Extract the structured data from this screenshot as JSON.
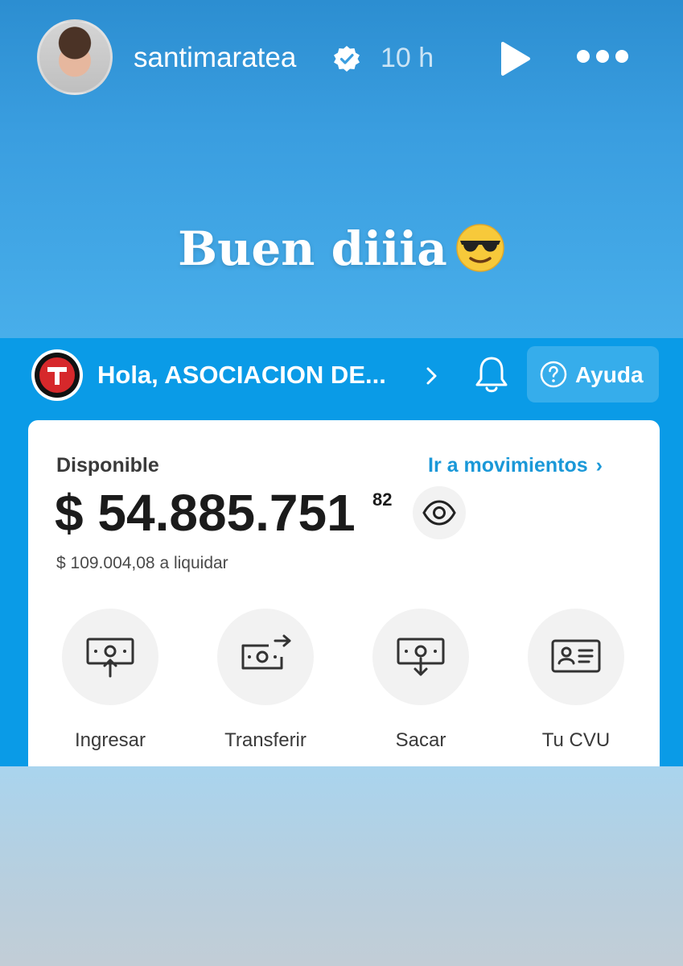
{
  "story": {
    "username": "santimaratea",
    "time_ago": "10 h",
    "caption": "Buen diiia",
    "caption_emoji": "smiling-face-with-sunglasses",
    "colors": {
      "story_bg": "#3a9ee0",
      "app_bg": "#0a9be7",
      "link": "#1a98d8"
    }
  },
  "app": {
    "greeting": "Hola, ASOCIACION DE...",
    "help_label": "Ayuda",
    "available_label": "Disponible",
    "movements_link": "Ir a movimientos",
    "balance_main": "$ 54.885.751",
    "balance_cents": "82",
    "to_settle": "$ 109.004,08 a liquidar",
    "actions": [
      {
        "label": "Ingresar",
        "icon": "money-in-icon"
      },
      {
        "label": "Transferir",
        "icon": "money-transfer-icon"
      },
      {
        "label": "Sacar",
        "icon": "money-out-icon"
      },
      {
        "label": "Tu CVU",
        "icon": "id-card-icon"
      }
    ]
  }
}
